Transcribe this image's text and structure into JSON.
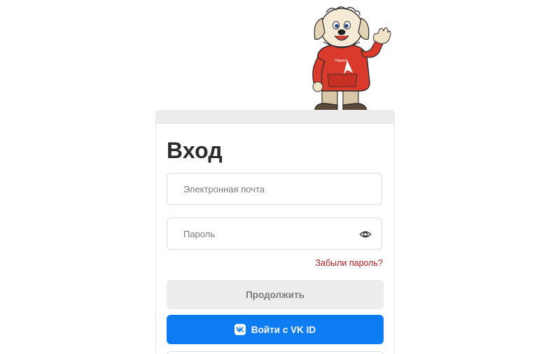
{
  "login": {
    "title": "Вход",
    "email_placeholder": "Электронная почта",
    "password_placeholder": "Пароль",
    "forgot_password": "Забыли пароль?",
    "continue_label": "Продолжить",
    "vk_label": "Войти с VK ID"
  },
  "colors": {
    "accent_blue": "#0d7bf2",
    "forgot_red": "#b0161b",
    "continue_bg": "#ededed",
    "mascot_hoodie": "#d93a2b"
  },
  "icons": {
    "password_toggle": "eye-icon",
    "vk": "vk-logo-icon",
    "mascot": "dog-mascot-illustration"
  }
}
